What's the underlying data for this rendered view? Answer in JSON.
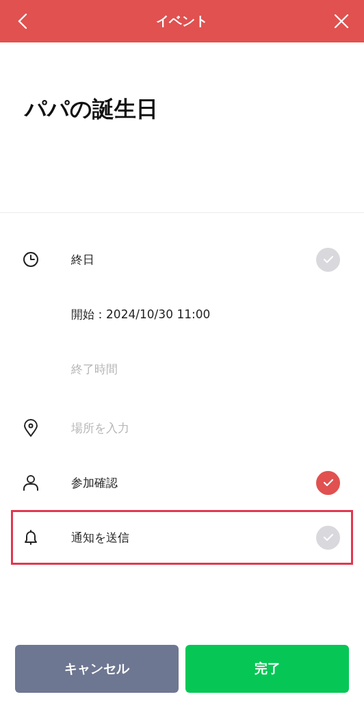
{
  "header": {
    "title": "イベント"
  },
  "event_title": "パパの誕生日",
  "rows": [
    {
      "kind": "all_day",
      "label": "終日",
      "checked": false,
      "highlighted": false
    },
    {
      "kind": "start",
      "label": "開始：2024/10/30 11:00",
      "highlighted": false
    },
    {
      "kind": "end",
      "placeholder": "終了時間",
      "highlighted": false
    },
    {
      "kind": "location",
      "placeholder": "場所を入力",
      "highlighted": false
    },
    {
      "kind": "attendance",
      "label": "参加確認",
      "checked": true,
      "highlighted": false
    },
    {
      "kind": "notify",
      "label": "通知を送信",
      "checked": false,
      "highlighted": true
    }
  ],
  "buttons": [
    {
      "kind": "cancel",
      "label": "キャンセル"
    },
    {
      "kind": "done",
      "label": "完了"
    }
  ]
}
